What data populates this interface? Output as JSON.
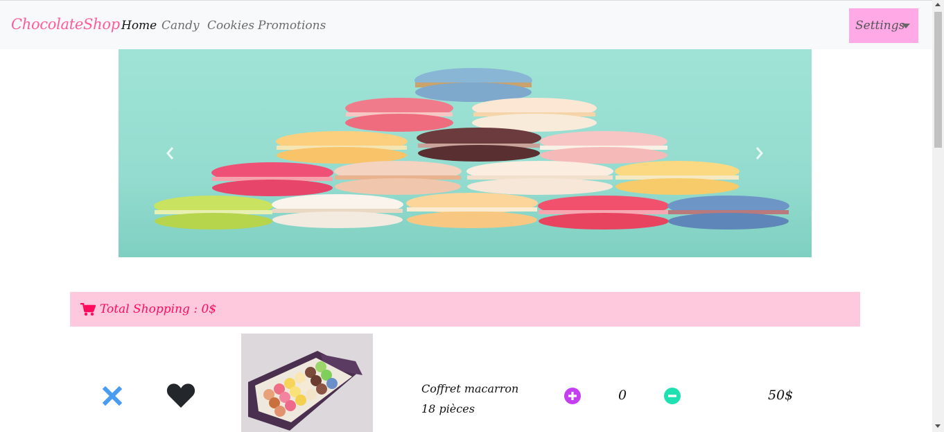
{
  "navbar": {
    "brand": "ChocolateShop",
    "links": [
      {
        "label": "Home",
        "active": true
      },
      {
        "label": "Candy",
        "active": false
      },
      {
        "label": "Cookies",
        "active": false
      },
      {
        "label": "Promotions",
        "active": false
      }
    ],
    "settings_label": "Settings"
  },
  "carousel": {
    "prev_icon": "chevron-left-icon",
    "next_icon": "chevron-right-icon"
  },
  "cart": {
    "total_label": "Total Shopping : 0$",
    "icon": "shopping-cart-icon",
    "accent_color": "#ff0b5e"
  },
  "products": [
    {
      "name_line1": "Coffret macarron",
      "name_line2": "18 pièces",
      "quantity": "0",
      "price": "50$",
      "remove_icon": "close-icon",
      "favorite_icon": "heart-icon",
      "increase_icon": "plus-circle-icon",
      "decrease_icon": "minus-circle-icon"
    }
  ],
  "colors": {
    "brand": "#ff5b98",
    "settings_bg": "#ffa9e6",
    "total_bg": "#ffc9dd",
    "remove": "#4a9cf0",
    "increase": "#c43ff0",
    "decrease": "#1fe0b0"
  }
}
